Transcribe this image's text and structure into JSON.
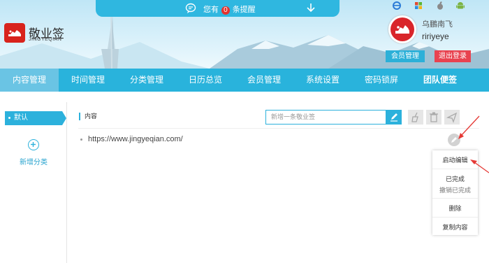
{
  "notification": {
    "prefix": "您有",
    "count": "0",
    "suffix": "条提醒"
  },
  "brand": {
    "name": "敬业签",
    "sub": "JINGYEQIAN"
  },
  "app_icons": [
    "ie-icon",
    "windows-icon",
    "apple-icon",
    "android-icon"
  ],
  "user": {
    "nickname": "乌鵬南飞",
    "account": "ririyeye",
    "member_btn": "会员管理",
    "logout_btn": "退出登录"
  },
  "nav": {
    "items": [
      "内容管理",
      "时间管理",
      "分类管理",
      "日历总览",
      "会员管理",
      "系统设置",
      "密码锁屏",
      "团队便签"
    ],
    "active": "内容管理"
  },
  "sidebar": {
    "default_category": "默认",
    "add_category": "新增分类"
  },
  "main": {
    "section_title": "内容",
    "new_placeholder": "新增一条敬业签"
  },
  "notes": [
    {
      "text": "https://www.jingyeqian.com/"
    }
  ],
  "context_menu": {
    "items": [
      "启动编辑",
      "已完成",
      "撤销已完成",
      "删除",
      "复制内容"
    ]
  },
  "colors": {
    "accent": "#29b3dc",
    "danger": "#e8424f",
    "brand_red": "#d8231c"
  }
}
